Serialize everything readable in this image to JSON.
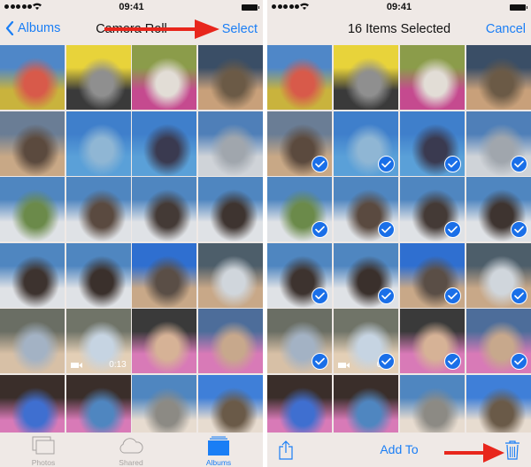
{
  "status_bar": {
    "time": "09:41",
    "signal_bars": 5,
    "wifi_icon": "wifi-icon",
    "battery_icon": "battery-icon"
  },
  "left_screen": {
    "navbar": {
      "back_label": "Albums",
      "back_icon": "chevron-left-icon",
      "title": "Camera Roll",
      "action_label": "Select"
    },
    "photos": [
      {
        "id": 1,
        "colors": [
          "#4f87c8",
          "#c9b33d",
          "#d85a4a"
        ]
      },
      {
        "id": 2,
        "colors": [
          "#e8d33a",
          "#3a3a3a",
          "#8f8f8f"
        ]
      },
      {
        "id": 3,
        "colors": [
          "#8b9c4a",
          "#c54a8f",
          "#e2ddd6"
        ]
      },
      {
        "id": 4,
        "colors": [
          "#3a4e66",
          "#c8a07a",
          "#6b5a46"
        ]
      },
      {
        "id": 5,
        "colors": [
          "#6a7d95",
          "#c8a886",
          "#5b4a3e"
        ]
      },
      {
        "id": 6,
        "colors": [
          "#3f7fcb",
          "#5aa0d8",
          "#8fb6d4"
        ]
      },
      {
        "id": 7,
        "colors": [
          "#3f7fcb",
          "#5aa0d8",
          "#3a3a50"
        ]
      },
      {
        "id": 8,
        "colors": [
          "#4f7fb8",
          "#cfd3d8",
          "#a0a6ad"
        ]
      },
      {
        "id": 9,
        "colors": [
          "#4f86c0",
          "#dfe2e6",
          "#6b8a4a"
        ]
      },
      {
        "id": 10,
        "colors": [
          "#4f86c0",
          "#dfe2e6",
          "#5a4a40"
        ]
      },
      {
        "id": 11,
        "colors": [
          "#4f86c0",
          "#dfe2e6",
          "#443a36"
        ]
      },
      {
        "id": 12,
        "colors": [
          "#4f86c0",
          "#dfe2e6",
          "#3e3430"
        ]
      },
      {
        "id": 13,
        "colors": [
          "#4f86c0",
          "#dfe2e6",
          "#3d332f"
        ]
      },
      {
        "id": 14,
        "colors": [
          "#4f86c0",
          "#dfe2e6",
          "#3a302c"
        ]
      },
      {
        "id": 15,
        "colors": [
          "#2f6fd0",
          "#c8a888",
          "#5a4e46"
        ]
      },
      {
        "id": 16,
        "colors": [
          "#4d5e6a",
          "#c8a888",
          "#d0d6dc"
        ]
      },
      {
        "id": 17,
        "colors": [
          "#6a6e64",
          "#d7c0a6",
          "#a3b2c4"
        ]
      },
      {
        "id": 18,
        "colors": [
          "#707468",
          "#e3cfb6",
          "#c6d4e2"
        ],
        "video": true,
        "duration": "0:13"
      },
      {
        "id": 19,
        "colors": [
          "#3a3a3a",
          "#d87ab7",
          "#d6b296"
        ]
      },
      {
        "id": 20,
        "colors": [
          "#4d6d9a",
          "#d87ab7",
          "#c7a88c"
        ]
      },
      {
        "id": 21,
        "colors": [
          "#3a2e2a",
          "#d87ab7",
          "#3f6fd0"
        ]
      },
      {
        "id": 22,
        "colors": [
          "#3a2e2a",
          "#d87ab7",
          "#4f86c0"
        ]
      },
      {
        "id": 23,
        "colors": [
          "#4f86c0",
          "#e7dcd0",
          "#8c8a84"
        ]
      },
      {
        "id": 24,
        "colors": [
          "#3f7fd8",
          "#e7dcd0",
          "#6a5a48"
        ]
      }
    ],
    "tabbar": [
      {
        "label": "Photos",
        "icon": "photos-icon",
        "active": false
      },
      {
        "label": "Shared",
        "icon": "cloud-icon",
        "active": false
      },
      {
        "label": "Albums",
        "icon": "albums-icon",
        "active": true
      }
    ]
  },
  "right_screen": {
    "navbar": {
      "title": "16 Items Selected",
      "action_label": "Cancel"
    },
    "selected_indices": [
      5,
      6,
      7,
      8,
      9,
      10,
      11,
      12,
      13,
      14,
      15,
      16,
      17,
      18,
      19,
      20
    ],
    "toolbar": {
      "share_icon": "share-icon",
      "add_to_label": "Add To",
      "trash_icon": "trash-icon"
    }
  },
  "annotations": {
    "arrow_color": "#e8261c"
  },
  "theme": {
    "accent": "#1a7ef5",
    "check_blue": "#1a6fe8",
    "bar_bg": "#efe9e6",
    "inactive_tab": "#a7a3a1"
  }
}
